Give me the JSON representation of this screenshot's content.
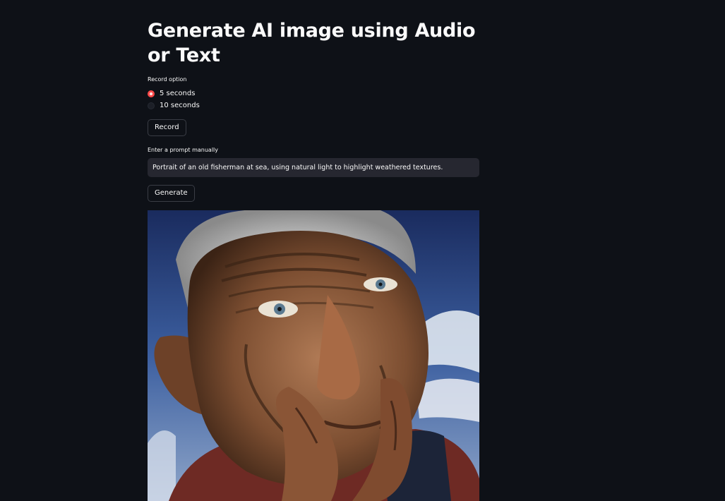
{
  "page": {
    "title": "Generate AI image using Audio or Text"
  },
  "record": {
    "label": "Record option",
    "options": [
      {
        "label": "5 seconds",
        "selected": true
      },
      {
        "label": "10 seconds",
        "selected": false
      }
    ],
    "button_label": "Record"
  },
  "prompt": {
    "label": "Enter a prompt manually",
    "value": "Portrait of an old fisherman at sea, using natural light to highlight weathered textures.",
    "button_label": "Generate"
  },
  "generated_image": {
    "alt": "Portrait of an old fisherman at sea, using natural light to highlight weathered textures."
  },
  "colors": {
    "background": "#0e1117",
    "accent": "#ff4b4b",
    "input_background": "#262730",
    "text": "#fafafa"
  }
}
